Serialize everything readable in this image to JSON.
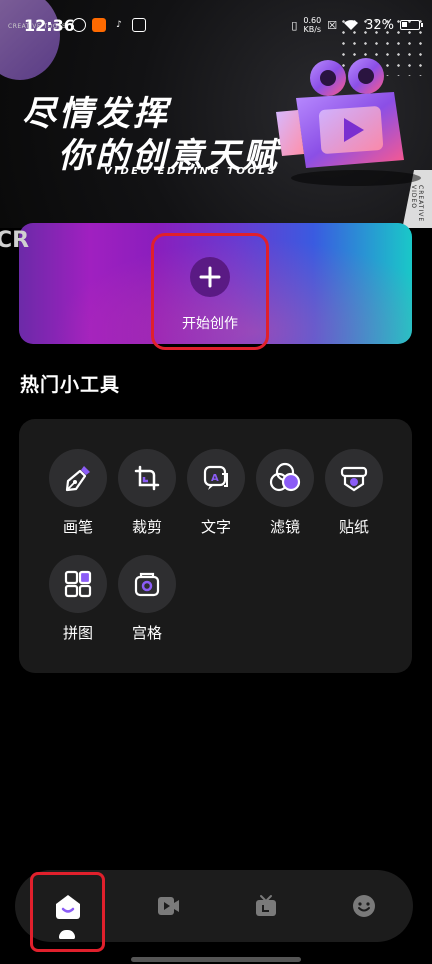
{
  "status_bar": {
    "time": "12:36",
    "speed_value": "0.60",
    "speed_unit": "KB/s",
    "battery": "32%"
  },
  "banner": {
    "tag": "CREATIVE TOOLS",
    "line1": "尽情发挥",
    "line2": "你的创意天赋",
    "subtitle": "VIDEO EDITING TOOLS",
    "side_text": "CREATIVE VIDEO",
    "partial_letters": "CR"
  },
  "start": {
    "label": "开始创作"
  },
  "tools_section": {
    "title": "热门小工具",
    "items": [
      {
        "label": "画笔",
        "icon": "pen-icon"
      },
      {
        "label": "裁剪",
        "icon": "crop-icon"
      },
      {
        "label": "文字",
        "icon": "text-icon"
      },
      {
        "label": "滤镜",
        "icon": "filter-icon"
      },
      {
        "label": "贴纸",
        "icon": "sticker-icon"
      },
      {
        "label": "拼图",
        "icon": "collage-icon"
      },
      {
        "label": "宫格",
        "icon": "grid-icon"
      }
    ]
  },
  "bottom_nav": {
    "items": [
      {
        "icon": "home-icon",
        "active": true
      },
      {
        "icon": "video-icon",
        "active": false
      },
      {
        "icon": "tv-icon",
        "active": false
      },
      {
        "icon": "face-icon",
        "active": false
      }
    ]
  },
  "colors": {
    "accent_purple": "#8b5cf6",
    "highlight_red": "#e0202c",
    "card_bg": "#1a1a1a"
  }
}
